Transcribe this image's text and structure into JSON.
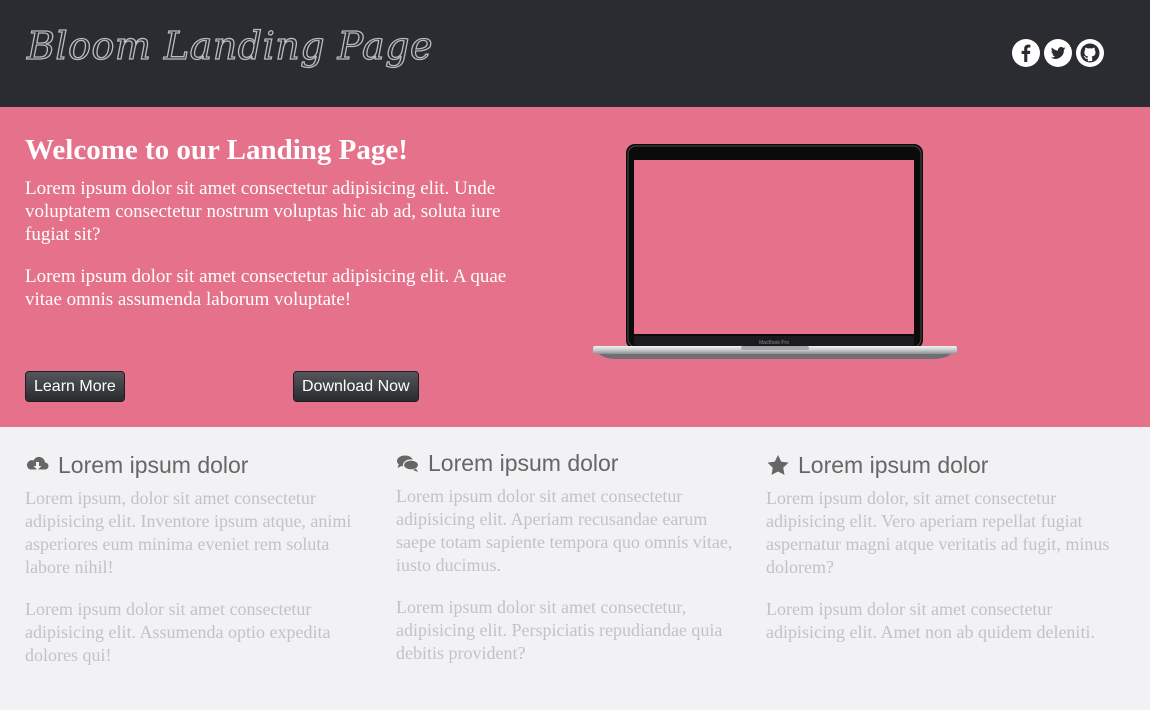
{
  "header": {
    "logo": "Bloom Landing Page",
    "social": [
      {
        "icon": "facebook-icon"
      },
      {
        "icon": "twitter-icon"
      },
      {
        "icon": "github-icon"
      }
    ]
  },
  "hero": {
    "title": "Welcome to our Landing Page!",
    "paragraph1": "Lorem ipsum dolor sit amet consectetur adipisicing elit. Unde voluptatem consectetur nostrum voluptas hic ab ad, soluta iure fugiat sit?",
    "paragraph2": "Lorem ipsum dolor sit amet consectetur adipisicing elit. A quae vitae omnis assumenda laborum voluptate!",
    "learn_more": "Learn More",
    "download_now": "Download Now",
    "laptop_brand": "MacBook Pro"
  },
  "features": [
    {
      "icon": "cloud-download-icon",
      "title": "Lorem ipsum dolor",
      "p1": "Lorem ipsum, dolor sit amet consectetur adipisicing elit. Inventore ipsum atque, animi asperiores eum minima eveniet rem soluta labore nihil!",
      "p2": "Lorem ipsum dolor sit amet consectetur adipisicing elit. Assumenda optio expedita dolores qui!"
    },
    {
      "icon": "comments-icon",
      "title": "Lorem ipsum dolor",
      "p1": "Lorem ipsum dolor sit amet consectetur adipisicing elit. Aperiam recusandae earum saepe totam sapiente tempora quo omnis vitae, iusto ducimus.",
      "p2": "Lorem ipsum dolor sit amet consectetur, adipisicing elit. Perspiciatis repudiandae quia debitis provident?"
    },
    {
      "icon": "star-icon",
      "title": "Lorem ipsum dolor",
      "p1": "Lorem ipsum dolor, sit amet consectetur adipisicing elit. Vero aperiam repellat fugiat aspernatur magni atque veritatis ad fugit, minus dolorem?",
      "p2": "Lorem ipsum dolor sit amet consectetur adipisicing elit. Amet non ab quidem deleniti."
    }
  ],
  "colors": {
    "header_bg": "#2a2c31",
    "hero_bg": "#e6718a",
    "features_bg": "#f2f2f4",
    "feature_title": "#666666",
    "feature_text": "#c3c3c6"
  }
}
